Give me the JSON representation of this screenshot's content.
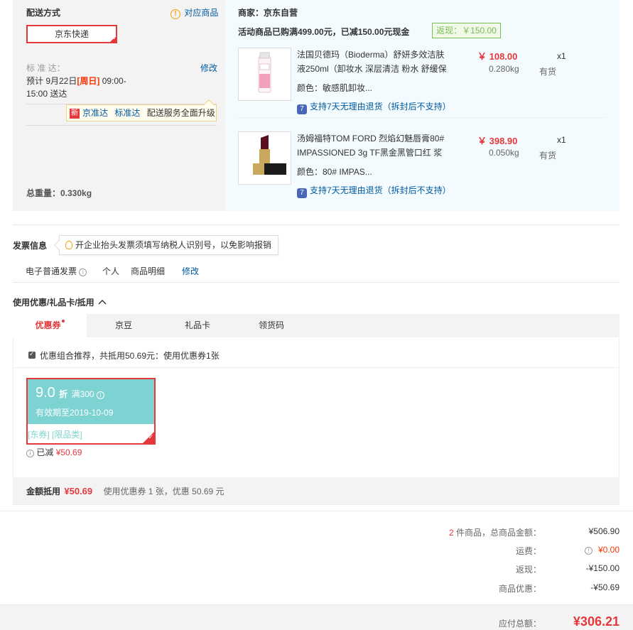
{
  "shipping": {
    "title": "配送方式",
    "matching_link": "对应商品",
    "method": "京东快递",
    "standard_label": "标 准 达：",
    "modify": "修改",
    "eta_prefix": "预计 9月22日",
    "eta_weekday": "[周日]",
    "eta_time_a": " 09:00-",
    "eta_time_b": "15:00 送达",
    "tip_tag": "新",
    "tip_brand": "京准达",
    "tip_std": "标准达",
    "tip_text": "配送服务全面升级",
    "total_weight": "总重量：0.330kg"
  },
  "merchant": {
    "name": "商家：京东自营",
    "promo": "活动商品已购满499.00元，已减150.00元现金",
    "cashback": "返现：￥150.00"
  },
  "products": [
    {
      "name": "法国贝德玛（Bioderma）舒妍多效洁肤液250ml（卸妆水 深层清洁 粉水 舒缓保",
      "price": "￥ 108.00",
      "qty": "x1",
      "weight": "0.280kg",
      "stock": "有货",
      "color": "颜色：敏感肌卸妆...",
      "return_icon": "7",
      "return": "支持7天无理由退货（拆封后不支持）"
    },
    {
      "name": "汤姆福特TOM FORD 烈焰幻魅唇膏80# IMPASSIONED 3g TF黑金黑管口红 浆果",
      "price": "￥ 398.90",
      "qty": "x1",
      "weight": "0.050kg",
      "stock": "有货",
      "color": "颜色：80# IMPAS...",
      "return_icon": "7",
      "return": "支持7天无理由退货（拆封后不支持）"
    }
  ],
  "invoice": {
    "title": "发票信息",
    "tip": "开企业抬头发票须填写纳税人识别号，以免影响报销",
    "type": "电子普通发票",
    "info_icon": "i",
    "person": "个人",
    "detail": "商品明细",
    "modify": "修改"
  },
  "discount": {
    "title": "使用优惠/礼品卡/抵用",
    "toggle_icon": "chevron-up-icon",
    "tabs": [
      "优惠券",
      "京豆",
      "礼品卡",
      "领货码"
    ],
    "recommend": "优惠组合推荐，共抵用50.69元：使用优惠券1张",
    "coupon": {
      "value": "9.0",
      "unit": "折",
      "condition": "满300",
      "info_icon": "i",
      "expiry": "有效期至2019-10-09",
      "tags": "[东券] [限品类]"
    },
    "reduced_label": "已减",
    "reduced_value": "¥50.69",
    "summary_label": "金额抵用",
    "summary_value": "¥50.69",
    "summary_detail": "使用优惠券 1 张，优惠 50.69 元"
  },
  "totals": {
    "count": "2",
    "count_label": " 件商品，总商品金额：",
    "goods_amount": "¥506.90",
    "freight_label": "运费：",
    "freight_info": "!",
    "freight": "¥0.00",
    "cashback_label": "返现：",
    "cashback": "-¥150.00",
    "discount_label": "商品优惠：",
    "discount": "-¥50.69",
    "payable_label": "应付总额：",
    "payable": "¥306.21"
  },
  "colors": {
    "brand_red": "#e4393c",
    "link_blue": "#005aa0",
    "coupon_teal": "#7dd3d1",
    "cashback_green": "#7abd54"
  }
}
